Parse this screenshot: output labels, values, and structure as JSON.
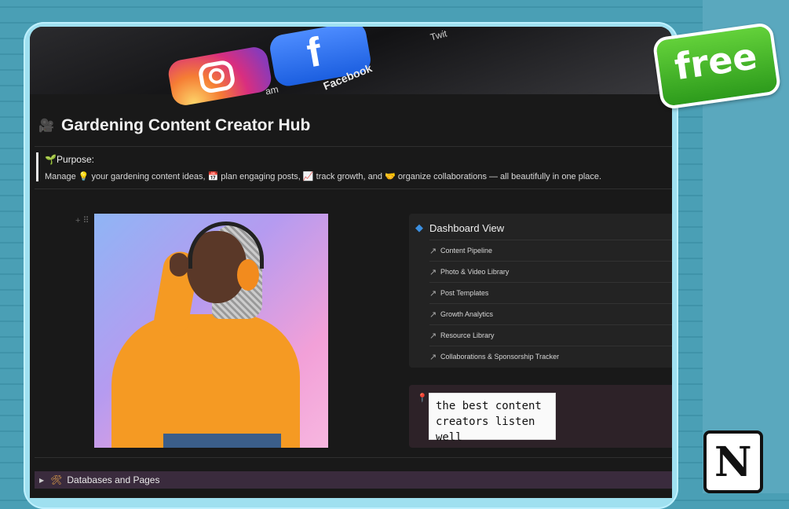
{
  "page": {
    "title": "Gardening Content Creator Hub",
    "title_icon": "film-camera-icon"
  },
  "banner": {
    "apps": [
      {
        "name": "Instagram",
        "label": "am"
      },
      {
        "name": "Facebook",
        "label": "Facebook"
      },
      {
        "name": "Twitter",
        "label": "Twit"
      }
    ]
  },
  "purpose": {
    "heading": "🌱Purpose:",
    "text": "Manage 💡 your gardening content ideas, 📅 plan engaging posts, 📈 track growth, and 🤝 organize collaborations — all beautifully in one place."
  },
  "dashboard": {
    "title": "Dashboard View",
    "icon": "diamond-icon",
    "items": [
      {
        "label": "Content Pipeline"
      },
      {
        "label": "Photo & Video Library"
      },
      {
        "label": "Post Templates"
      },
      {
        "label": "Growth Analytics"
      },
      {
        "label": "Resource Library"
      },
      {
        "label": "Collaborations & Sponsorship Tracker"
      }
    ]
  },
  "quote": {
    "line1": "the best content",
    "line2": "creators listen well"
  },
  "databases_toggle": {
    "label": "Databases and Pages",
    "icon": "tools-icon"
  },
  "badges": {
    "free": "free",
    "notion": "N"
  },
  "colors": {
    "background": "#4a9fb5",
    "frame": "#9fe0f0",
    "window": "#191919",
    "free_green": "#3fae25",
    "dashboard_icon": "#3b8fe0",
    "db_row": "#3a2b3d"
  }
}
